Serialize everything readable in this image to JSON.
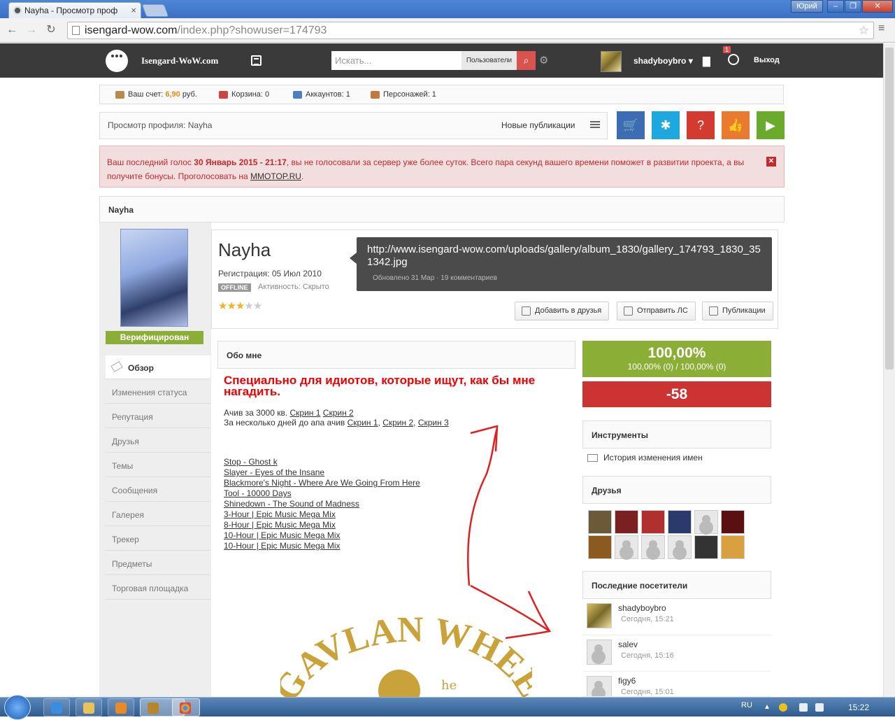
{
  "browser": {
    "tab_title": "Nayha - Просмотр проф",
    "url_host": "isengard-wow.com",
    "url_path": "/index.php?showuser=174793",
    "user_chip": "Юрий"
  },
  "site": {
    "name": "Isengard-WoW.com",
    "search_placeholder": "Искать...",
    "search_scope": "Пользователи",
    "username": "shadyboybro",
    "notif_count": "1",
    "logout": "Выход"
  },
  "account": {
    "balance_label": "Ваш счет:",
    "balance_value": "6,90",
    "balance_unit": "руб.",
    "cart": "Корзина: 0",
    "accounts": "Аккаунтов: 1",
    "characters": "Персонажей: 1"
  },
  "breadcrumb": {
    "label": "Просмотр профиля: Nayha",
    "new_publications": "Новые публикации"
  },
  "tiles": [
    {
      "icon": "cart-icon",
      "color": "#3b6cb4"
    },
    {
      "icon": "gear-icon",
      "color": "#1fa7df"
    },
    {
      "icon": "help-icon",
      "color": "#d43b30"
    },
    {
      "icon": "thumbs-up-icon",
      "color": "#ea7a30"
    },
    {
      "icon": "play-icon",
      "color": "#6aab2e"
    }
  ],
  "alert": {
    "pre": "Ваш последний голос ",
    "date": "30 Январь 2015 - 21:17",
    "post": ", вы не голосовали за сервер уже более суток. Всего пара секунд вашего времени поможет в развитии проекта, а вы получите бонусы. Проголосовать на ",
    "link": "MMOTOP.RU",
    "end": "."
  },
  "section_title": "Nayha",
  "sidebar": {
    "verified": "Верифицирован",
    "items": [
      "Обзор",
      "Изменения статуса",
      "Репутация",
      "Друзья",
      "Темы",
      "Сообщения",
      "Галерея",
      "Трекер",
      "Предметы",
      "Торговая площадка"
    ]
  },
  "profile": {
    "name": "Nayha",
    "registered": "Регистрация: 05 Июл 2010",
    "status_badge": "OFFLINE",
    "activity": "Активность: Скрыто",
    "rating_stars": 3,
    "rating_max": 5,
    "status_text": "http://www.isengard-wow.com/uploads/gallery/album_1830/gallery_174793_1830_351342.jpg",
    "status_meta": "Обновлено 31 Мар · 19 комментариев",
    "buttons": {
      "add_friend": "Добавить в друзья",
      "send_pm": "Отправить ЛС",
      "publications": "Публикации"
    }
  },
  "about": {
    "header": "Обо мне",
    "title": "Специально для идиотов, которые ищут, как бы мне нагадить.",
    "line1_text": "Ачив за 3000 кв. ",
    "line1_links": [
      "Скрин 1",
      "Скрин 2"
    ],
    "line2_text": "За несколько дней до апа ачив ",
    "line2_links": [
      "Скрин 1",
      "Скрин 2",
      "Скрин 3"
    ],
    "tracks": [
      "Stop - Ghost k",
      "Slayer - Eyes of the Insane",
      "Blackmore's Night - Where Are We Going From Here",
      "Tool - 10000 Days",
      "Shinedown - The Sound of Madness",
      "3-Hour | Epic Music Mega Mix",
      "8-Hour | Epic Music Mega Mix",
      "10-Hour | Epic Music Mega Mix",
      "10-Hour | Epic Music Mega Mix"
    ],
    "logo_text": "GAVLAN WHEE",
    "logo_small": "he"
  },
  "reputation": {
    "total": "100,00%",
    "detail": "100,00% (0)  /  100,00% (0)",
    "negative": "-58"
  },
  "tools": {
    "header": "Инструменты",
    "item": "История изменения имен"
  },
  "friends": {
    "header": "Друзья",
    "count": 12
  },
  "visitors": {
    "header": "Последние посетители",
    "list": [
      {
        "name": "shadyboybro",
        "time": "Сегодня, 15:21"
      },
      {
        "name": "salev",
        "time": "Сегодня, 15:16"
      },
      {
        "name": "figy6",
        "time": "Сегодня, 15:01"
      }
    ]
  },
  "taskbar": {
    "lang": "RU",
    "clock": "15:22"
  }
}
